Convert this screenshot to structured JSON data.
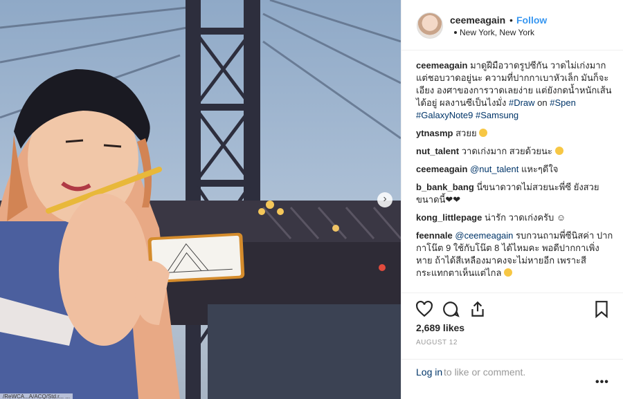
{
  "post": {
    "username": "ceemeagain",
    "separator": "•",
    "follow_label": "Follow",
    "location": "New York, New York",
    "likes": "2,689 likes",
    "date": "AUGUST 12",
    "photo_caption": "/ReWCA...A/ACQ/Std.r... ..."
  },
  "caption": {
    "username": "ceemeagain",
    "text": "มาดูฝีมือวาดรูปซีกัน วาดไม่เก่งมาก แต่ชอบวาดอยู่นะ ความที่ปากกาเบาหัวเล็ก มันก็จะเอียง องศาของการวาดเลยง่าย แต่ยังกดน้ำหนักเส้นได้อยู่ ผลงานซีเป็นไงมั่ง",
    "tags": [
      "#Draw",
      "#Spen",
      "#GalaxyNote9",
      "#Samsung"
    ],
    "on_word": "on"
  },
  "comments": [
    {
      "user": "ytnasmp",
      "text": "สวยย"
    },
    {
      "user": "nut_talent",
      "text": "วาดเก่งมาก สวยด้วยนะ"
    },
    {
      "user": "ceemeagain",
      "mention": "@nut_talent",
      "text": "แหะๆดีใจ"
    },
    {
      "user": "b_bank_bang",
      "text": "นี่ขนาดวาดไม่สวยนะพี่ซี ยังสวยขนาดนี้❤❤"
    },
    {
      "user": "kong_littlepage",
      "text": "น่ารัก วาดเก่งครับ ☺"
    },
    {
      "user": "feennale",
      "mention": "@ceemeagain",
      "text": "รบกวนถามพี่ซีนิสค่า ปากกาโน๊ต 9 ใช้กับโน๊ต 8 ได้ไหมคะ พอดีปากกาเพิ่งหาย ถ้าได้สีเหลืองมาคงจะไม่หายอีก เพราะสีกระแทกตาเห็นแต่ไกล"
    }
  ],
  "login": {
    "link": "Log in",
    "rest": "to like or comment."
  },
  "more_label": "•••",
  "next_label": "›",
  "icons": {
    "heart": "heart-icon",
    "comment": "comment-icon",
    "share": "share-icon",
    "bookmark": "bookmark-icon",
    "pin": "location-pin-icon"
  },
  "colors": {
    "link": "#3897f0",
    "tag": "#003569",
    "muted": "#999999"
  }
}
